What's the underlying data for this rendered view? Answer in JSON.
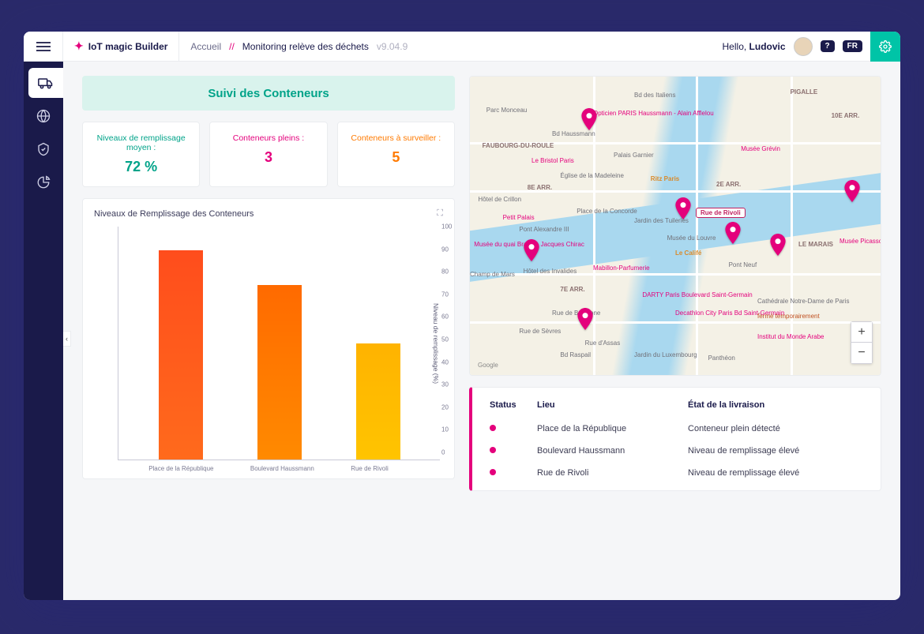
{
  "brand": "IoT magic Builder",
  "breadcrumb": {
    "home": "Accueil",
    "sep": "//",
    "current": "Monitoring relève des déchets",
    "version": "v9.04.9"
  },
  "greeting_prefix": "Hello, ",
  "greeting_name": "Ludovic",
  "lang_badge": "FR",
  "help_badge": "?",
  "banner_title": "Suivi des Conteneurs",
  "kpis": [
    {
      "label": "Niveaux de remplissage moyen :",
      "value": "72 %"
    },
    {
      "label": "Conteneurs pleins :",
      "value": "3"
    },
    {
      "label": "Conteneurs à surveiller :",
      "value": "5"
    }
  ],
  "chart_title": "Niveaux de Remplissage des Conteneurs",
  "chart_ylabel": "Niveau de remplissage (%)",
  "chart_data": {
    "type": "bar",
    "categories": [
      "Place de la République",
      "Boulevard Haussmann",
      "Rue de Rivoli"
    ],
    "values": [
      90,
      75,
      50
    ],
    "title": "Niveaux de Remplissage des Conteneurs",
    "xlabel": "",
    "ylabel": "Niveau de remplissage (%)",
    "ylim": [
      0,
      100
    ],
    "ticks": [
      100,
      90,
      80,
      70,
      60,
      50,
      40,
      30,
      20,
      10,
      0
    ]
  },
  "map": {
    "callout": "Rue de Rivoli",
    "attribution": "Google",
    "pois": {
      "d1": "FAUBOURG-DU-ROULE",
      "d2": "8E ARR.",
      "d3": "7E ARR.",
      "d4": "2E ARR.",
      "d5": "10E ARR.",
      "d6": "LE MARAIS",
      "d7": "PIGALLE",
      "p1": "Parc Monceau",
      "p2": "Opticien PARIS Haussmann - Alain Afflelou",
      "p3": "Bd Haussmann",
      "p4": "Bd des Italiens",
      "p5": "Le Bristol Paris",
      "p6": "Palais Garnier",
      "p7": "Musée Grévin",
      "p8": "Église de la Madeleine",
      "p9": "Ritz Paris",
      "p10": "Hôtel de Crillon",
      "p11": "Petit Palais",
      "p12": "Pont Alexandre III",
      "p13": "Place de la Concorde",
      "p14": "Jardin des Tuileries",
      "p15": "Musée du quai Branly - Jacques Chirac",
      "p16": "Le Califé",
      "p17": "Musée du Louvre",
      "p18": "Pont Neuf",
      "p19": "Champ de Mars",
      "p20": "Hôtel des Invalides",
      "p21": "Mabillon-Parfumerie",
      "p22": "Rue de Babylone",
      "p23": "Rue d'Assas",
      "p24": "DARTY Paris Boulevard Saint-Germain",
      "p25": "Decathlon City Paris Bd Saint-Germain",
      "p26": "Cathédrale Notre-Dame de Paris",
      "p27": "Institut du Monde Arabe",
      "p28": "Jardin du Luxembourg",
      "p29": "Panthéon",
      "p30": "Musée Picasso",
      "p31": "Rue de Sèvres",
      "p32": "Bd Raspail",
      "p33": "fermé temporairement"
    }
  },
  "table": {
    "headers": {
      "status": "Status",
      "lieu": "Lieu",
      "etat": "État de la livraison"
    },
    "rows": [
      {
        "lieu": "Place de la République",
        "etat": "Conteneur plein détecté"
      },
      {
        "lieu": "Boulevard Haussmann",
        "etat": "Niveau de remplissage élevé"
      },
      {
        "lieu": "Rue de Rivoli",
        "etat": "Niveau de remplissage élevé"
      }
    ]
  }
}
